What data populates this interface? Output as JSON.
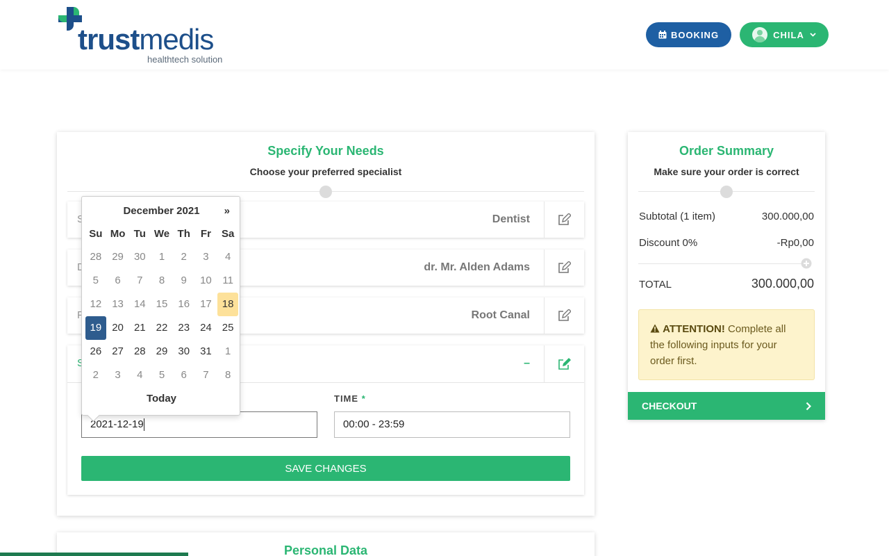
{
  "brand": {
    "name_bold": "trust",
    "name_regular": "medis",
    "tagline": "healthtech solution",
    "colors": {
      "blue": "#1d4f8a",
      "green": "#2bb673"
    }
  },
  "header": {
    "booking_label": "BOOKING",
    "user_label": "CHILA"
  },
  "needs": {
    "title": "Specify Your Needs",
    "subtitle": "Choose your preferred specialist",
    "rows": [
      {
        "label": "S",
        "value": "Dentist"
      },
      {
        "label": "D",
        "value": "dr. Mr. Alden Adams"
      },
      {
        "label": "P",
        "value": "Root Canal"
      }
    ],
    "open_row": {
      "label": "S",
      "value": "–"
    },
    "date_value": "2021-12-19",
    "time_label": "TIME",
    "required_mark": "*",
    "time_value": "00:00 - 23:59",
    "save_label": "SAVE CHANGES"
  },
  "datepicker": {
    "title": "December 2021",
    "next": "»",
    "weekdays": [
      "Su",
      "Mo",
      "Tu",
      "We",
      "Th",
      "Fr",
      "Sa"
    ],
    "weeks": [
      [
        "28",
        "29",
        "30",
        "1",
        "2",
        "3",
        "4"
      ],
      [
        "5",
        "6",
        "7",
        "8",
        "9",
        "10",
        "11"
      ],
      [
        "12",
        "13",
        "14",
        "15",
        "16",
        "17",
        "18"
      ],
      [
        "19",
        "20",
        "21",
        "22",
        "23",
        "24",
        "25"
      ],
      [
        "26",
        "27",
        "28",
        "29",
        "30",
        "31",
        "1"
      ],
      [
        "2",
        "3",
        "4",
        "5",
        "6",
        "7",
        "8"
      ]
    ],
    "today_label": "Today"
  },
  "summary": {
    "title": "Order Summary",
    "subtitle": "Make sure your order is correct",
    "subtotal_label": "Subtotal (1 item)",
    "subtotal_value": "300.000,00",
    "discount_label": "Discount 0%",
    "discount_value": "-Rp0,00",
    "total_label": "TOTAL",
    "total_value": "300.000,00",
    "attention_title": "ATTENTION!",
    "attention_text": " Complete all the following inputs for your order first.",
    "checkout_label": "CHECKOUT"
  },
  "personal": {
    "title": "Personal Data"
  }
}
